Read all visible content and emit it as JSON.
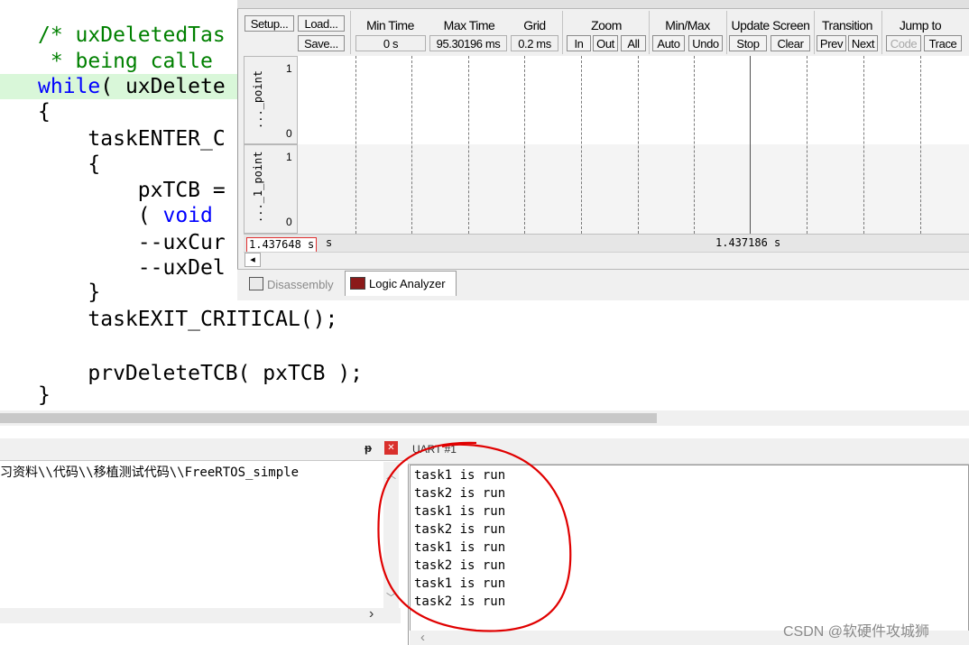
{
  "editor": {
    "lines": [
      "/* uxDeletedTas",
      " * being calle",
      "while( uxDelete",
      "{",
      "    taskENTER_C",
      "    {",
      "        pxTCB = ",
      "        ( void ",
      "        --uxCur",
      "        --uxDel",
      "    }",
      "    taskEXIT_CRITICAL();",
      "",
      "    prvDeleteTCB( pxTCB );",
      "}"
    ],
    "keyword_while": "while",
    "keyword_void": "void"
  },
  "logic_analyzer": {
    "toolbar": {
      "setup": "Setup...",
      "load": "Load...",
      "save": "Save...",
      "min_time_label": "Min Time",
      "min_time_value": "0 s",
      "max_time_label": "Max Time",
      "max_time_value": "95.30196 ms",
      "grid_label": "Grid",
      "grid_value": "0.2 ms",
      "zoom_label": "Zoom",
      "zoom_in": "In",
      "zoom_out": "Out",
      "zoom_all": "All",
      "minmax_label": "Min/Max",
      "auto": "Auto",
      "undo": "Undo",
      "update_label": "Update Screen",
      "stop": "Stop",
      "clear": "Clear",
      "transition_label": "Transition",
      "prev": "Prev",
      "next": "Next",
      "jump_label": "Jump to",
      "code": "Code",
      "trace": "Trace"
    },
    "signals": [
      {
        "name": "..._point",
        "high": "1",
        "low": "0"
      },
      {
        "name": "..._1_point",
        "high": "1",
        "low": "0"
      }
    ],
    "cursor_time_left": "1.437648 s",
    "cursor_time_suffix": "s",
    "cursor_time_center": "1.437186 s",
    "scroll_left_arrow": "◂",
    "tabs": [
      {
        "label": "Disassembly",
        "active": false
      },
      {
        "label": "Logic Analyzer",
        "active": true
      }
    ]
  },
  "build_output": {
    "path_text": "习资料\\\\代码\\\\移植测试代码\\\\FreeRTOS_simple",
    "pin_icon": "ᵽ",
    "close_icon": "✕",
    "scroll_down": "﹀",
    "scroll_right": "›"
  },
  "uart": {
    "title": "UART #1",
    "lines": [
      "task1 is run",
      "task2 is run",
      "task1 is run",
      "task2 is run",
      "task1 is run",
      "task2 is run",
      "task1 is run",
      "task2 is run"
    ],
    "scroll_up": "︿",
    "scroll_left": "‹"
  },
  "watermark": "CSDN @软硬件攻城狮",
  "colors": {
    "comment": "#008000",
    "keyword": "#0000ff",
    "highlight_line": "#d9f7d9",
    "annotation_red": "#e00000",
    "close_button": "#d9302c"
  }
}
